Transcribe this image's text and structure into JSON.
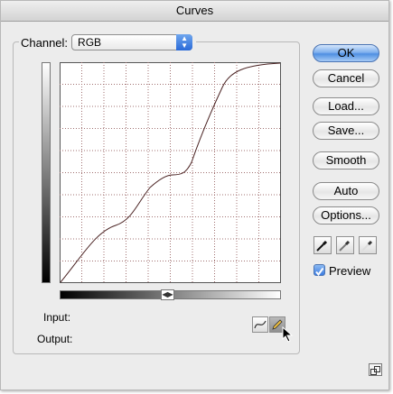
{
  "window": {
    "title": "Curves"
  },
  "channel": {
    "label": "Channel:",
    "value": "RGB"
  },
  "labels": {
    "input": "Input:",
    "output": "Output:"
  },
  "buttons": {
    "ok": "OK",
    "cancel": "Cancel",
    "load": "Load...",
    "save": "Save...",
    "smooth": "Smooth",
    "auto": "Auto",
    "options": "Options..."
  },
  "preview": {
    "label": "Preview",
    "checked": true
  },
  "colors": {
    "accent": "#4f8fe2",
    "curve": "#4a2222",
    "grid": "#a07070"
  },
  "tools": {
    "point_tool": "curve-point-icon",
    "pencil_tool": "pencil-icon"
  },
  "icons": [
    "black-eyedropper-icon",
    "gray-eyedropper-icon",
    "white-eyedropper-icon",
    "gradient-toggle-icon",
    "expand-icon"
  ]
}
